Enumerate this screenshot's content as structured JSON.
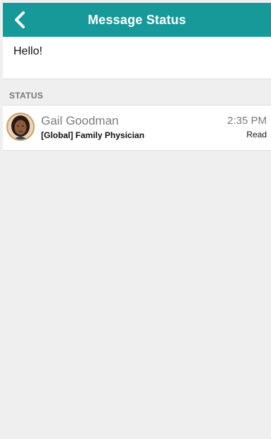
{
  "header": {
    "title": "Message Status",
    "back_icon": "chevron-left-icon"
  },
  "message": {
    "text": "Hello!"
  },
  "status_section": {
    "label": "STATUS",
    "recipients": [
      {
        "name": "Gail Goodman",
        "role": "[Global] Family Physician",
        "time": "2:35 PM",
        "status": "Read"
      }
    ]
  },
  "colors": {
    "header_bg": "#17999a",
    "page_bg": "#efefef",
    "muted_text": "#7b7b7b"
  }
}
